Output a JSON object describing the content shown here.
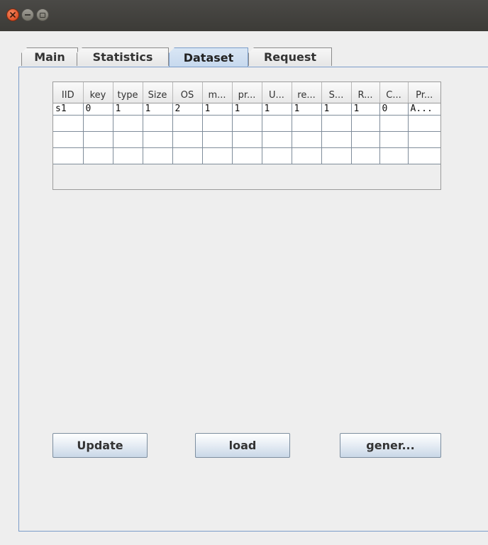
{
  "tabs": [
    {
      "label": "Main"
    },
    {
      "label": "Statistics"
    },
    {
      "label": "Dataset",
      "active": true
    },
    {
      "label": "Request"
    }
  ],
  "table": {
    "columns": [
      "IID",
      "key",
      "type",
      "Size",
      "OS",
      "m...",
      "pr...",
      "U...",
      "re...",
      "S...",
      "R...",
      "C...",
      "Pr..."
    ],
    "rows": [
      [
        "s1",
        "0",
        "1",
        "1",
        "2",
        "1",
        "1",
        "1",
        "1",
        "1",
        "1",
        "0",
        "A..."
      ],
      [
        "",
        "",
        "",
        "",
        "",
        "",
        "",
        "",
        "",
        "",
        "",
        "",
        ""
      ],
      [
        "",
        "",
        "",
        "",
        "",
        "",
        "",
        "",
        "",
        "",
        "",
        "",
        ""
      ],
      [
        "",
        "",
        "",
        "",
        "",
        "",
        "",
        "",
        "",
        "",
        "",
        "",
        ""
      ]
    ]
  },
  "buttons": {
    "update": "Update",
    "load": "load",
    "generate": "gener..."
  },
  "icons": {
    "close": "close-icon",
    "minimize": "minimize-icon",
    "maximize": "maximize-icon"
  }
}
